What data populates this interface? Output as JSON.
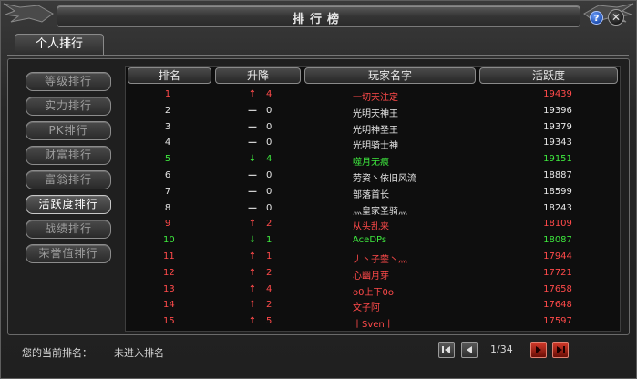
{
  "window": {
    "title": "排行榜"
  },
  "tabs": [
    {
      "label": "个人排行",
      "active": true
    }
  ],
  "sidebar": {
    "items": [
      {
        "label": "等级排行",
        "active": false
      },
      {
        "label": "实力排行",
        "active": false
      },
      {
        "label": "PK排行",
        "active": false
      },
      {
        "label": "财富排行",
        "active": false
      },
      {
        "label": "富翁排行",
        "active": false
      },
      {
        "label": "活跃度排行",
        "active": true
      },
      {
        "label": "战绩排行",
        "active": false
      },
      {
        "label": "荣誉值排行",
        "active": false
      }
    ]
  },
  "table": {
    "headers": {
      "rank": "排名",
      "change": "升降",
      "name": "玩家名字",
      "score": "活跃度"
    },
    "rows": [
      {
        "rank": "1",
        "arrow": "↑",
        "change": "4",
        "name": "一切天注定",
        "score": "19439",
        "color": "red"
      },
      {
        "rank": "2",
        "arrow": "—",
        "change": "0",
        "name": "光明天神王",
        "score": "19396",
        "color": "white"
      },
      {
        "rank": "3",
        "arrow": "—",
        "change": "0",
        "name": "光明神圣王",
        "score": "19379",
        "color": "white"
      },
      {
        "rank": "4",
        "arrow": "—",
        "change": "0",
        "name": "光明骑士神",
        "score": "19343",
        "color": "white"
      },
      {
        "rank": "5",
        "arrow": "↓",
        "change": "4",
        "name": "噬月无痕",
        "score": "19151",
        "color": "green"
      },
      {
        "rank": "6",
        "arrow": "—",
        "change": "0",
        "name": "劳资丶依旧风流",
        "score": "18887",
        "color": "white"
      },
      {
        "rank": "7",
        "arrow": "—",
        "change": "0",
        "name": "部落首长",
        "score": "18599",
        "color": "white"
      },
      {
        "rank": "8",
        "arrow": "—",
        "change": "0",
        "name": "灬皇家圣骑灬",
        "score": "18243",
        "color": "white"
      },
      {
        "rank": "9",
        "arrow": "↑",
        "change": "2",
        "name": "从头乱来",
        "score": "18109",
        "color": "red"
      },
      {
        "rank": "10",
        "arrow": "↓",
        "change": "1",
        "name": "AceDPs",
        "score": "18087",
        "color": "green"
      },
      {
        "rank": "11",
        "arrow": "↑",
        "change": "1",
        "name": "丿丶子蓥丶灬",
        "score": "17944",
        "color": "red"
      },
      {
        "rank": "12",
        "arrow": "↑",
        "change": "2",
        "name": "心幽月芽",
        "score": "17721",
        "color": "red"
      },
      {
        "rank": "13",
        "arrow": "↑",
        "change": "4",
        "name": "o0上下0o",
        "score": "17658",
        "color": "red"
      },
      {
        "rank": "14",
        "arrow": "↑",
        "change": "2",
        "name": "文子阿",
        "score": "17648",
        "color": "red"
      },
      {
        "rank": "15",
        "arrow": "↑",
        "change": "5",
        "name": "丨Sven丨",
        "score": "17597",
        "color": "red"
      }
    ]
  },
  "footer": {
    "current_rank_label": "您的当前排名：",
    "current_rank_value": "未进入排名",
    "page_indicator": "1/34"
  },
  "icons": {
    "help": "help-icon",
    "close": "close-icon",
    "first": "first-page-icon",
    "prev": "prev-page-icon",
    "next": "next-page-icon",
    "last": "last-page-icon"
  },
  "colors": {
    "rising": "#ff4a4a",
    "falling": "#3ee83e",
    "unchanged": "#e6e6e6",
    "accent_button": "#d43a2a"
  }
}
